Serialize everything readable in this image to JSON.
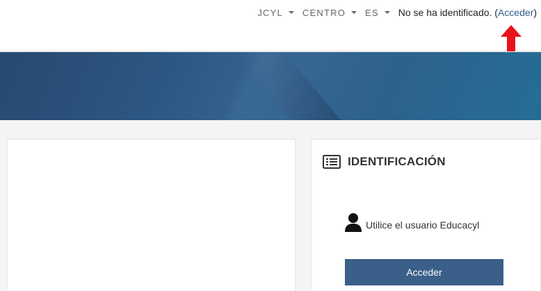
{
  "topnav": {
    "items": [
      {
        "label": "JCYL"
      },
      {
        "label": "CENTRO"
      },
      {
        "label": "ES"
      }
    ],
    "login_status": "No se ha identificado.",
    "login_link": "Acceder",
    "paren_open": "(",
    "paren_close": ")"
  },
  "colors": {
    "accent": "#3a5f88",
    "annotation_arrow": "#e8141c"
  },
  "login_block": {
    "title": "IDENTIFICACIÓN",
    "title_icon": "list-icon",
    "user_icon": "user-icon",
    "user_hint": "Utilice el usuario Educacyl",
    "button_label": "Acceder"
  }
}
